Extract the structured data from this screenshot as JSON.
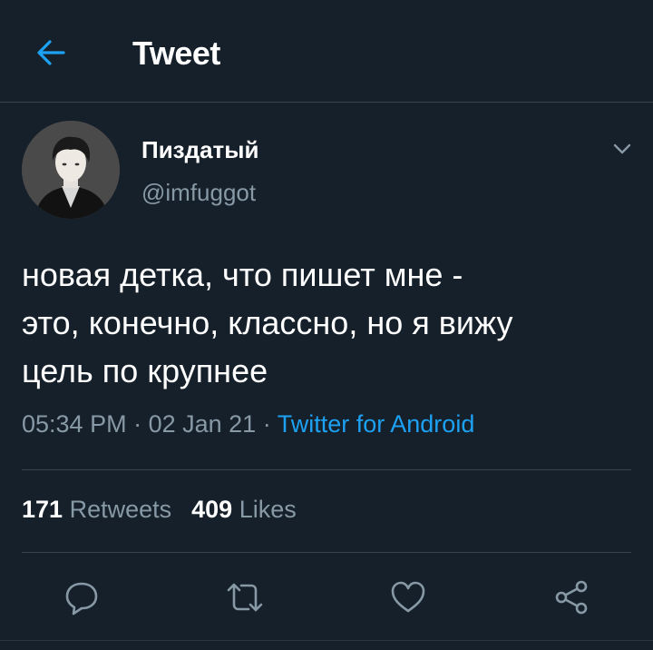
{
  "header": {
    "title": "Tweet",
    "back_icon": "arrow-left-icon"
  },
  "colors": {
    "background": "#15202b",
    "accent": "#1da1f2",
    "muted": "#8899a6",
    "divider": "#38444d"
  },
  "user": {
    "name": "Пиздатый",
    "handle": "@imfuggot"
  },
  "tweet": {
    "lines": [
      "новая детка, что пишет мне -",
      "это, конечно, классно, но я вижу",
      "цель по крупнее"
    ],
    "time": "05:34 PM",
    "date": "02 Jan 21",
    "source": "Twitter for Android"
  },
  "stats": {
    "retweets_count": "171",
    "retweets_label": "Retweets",
    "likes_count": "409",
    "likes_label": "Likes"
  },
  "actions": [
    "reply-icon",
    "retweet-icon",
    "like-icon",
    "share-icon"
  ]
}
